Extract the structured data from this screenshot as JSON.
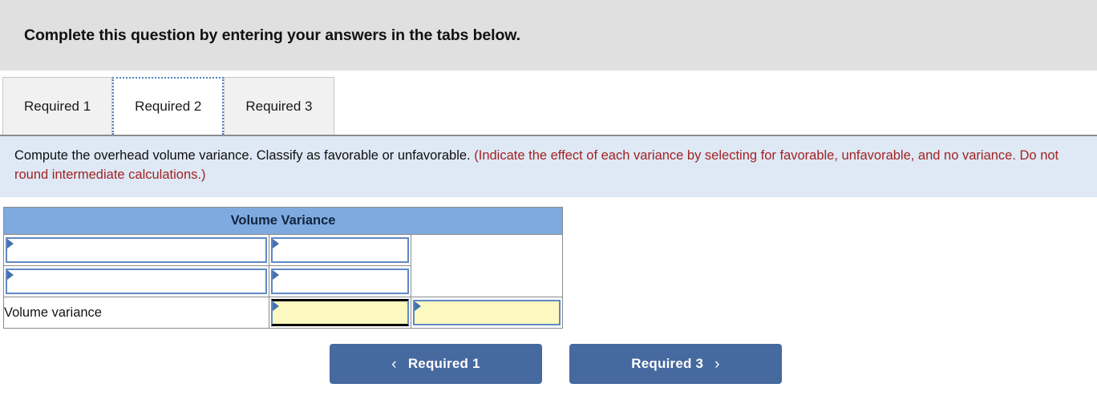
{
  "banner": {
    "title": "Complete this question by entering your answers in the tabs below."
  },
  "tabs": [
    {
      "label": "Required 1",
      "active": false
    },
    {
      "label": "Required 2",
      "active": true
    },
    {
      "label": "Required 3",
      "active": false
    }
  ],
  "instructions": {
    "black_text": "Compute the overhead volume variance. Classify as favorable or unfavorable.",
    "red_text": "(Indicate the effect of each variance by selecting for favorable, unfavorable, and no variance. Do not round intermediate calculations.)"
  },
  "table": {
    "header": "Volume Variance",
    "rows": [
      {
        "label": "",
        "label_is_input": true,
        "mid_value": "",
        "right_value": "",
        "right_spans": true,
        "highlight": false
      },
      {
        "label": "",
        "label_is_input": true,
        "mid_value": "",
        "right_value": "",
        "right_spans": false,
        "highlight": false
      },
      {
        "label": "Volume variance",
        "label_is_input": false,
        "mid_value": "",
        "right_value": "",
        "right_spans": false,
        "highlight": true
      }
    ]
  },
  "nav": {
    "prev_label": "Required 1",
    "prev_icon": "chevron-left-icon",
    "prev_chevron": "‹",
    "next_label": "Required 3",
    "next_icon": "chevron-right-icon",
    "next_chevron": "›"
  },
  "colors": {
    "banner_bg": "#e0e0e0",
    "instructions_bg": "#dee9f5",
    "instructions_red": "#a32323",
    "table_header_bg": "#7faae0",
    "input_border": "#5f89c4",
    "highlight_yellow": "#fbf8c0",
    "button_blue": "#46699f",
    "active_tab_border": "#4f7fbf"
  }
}
